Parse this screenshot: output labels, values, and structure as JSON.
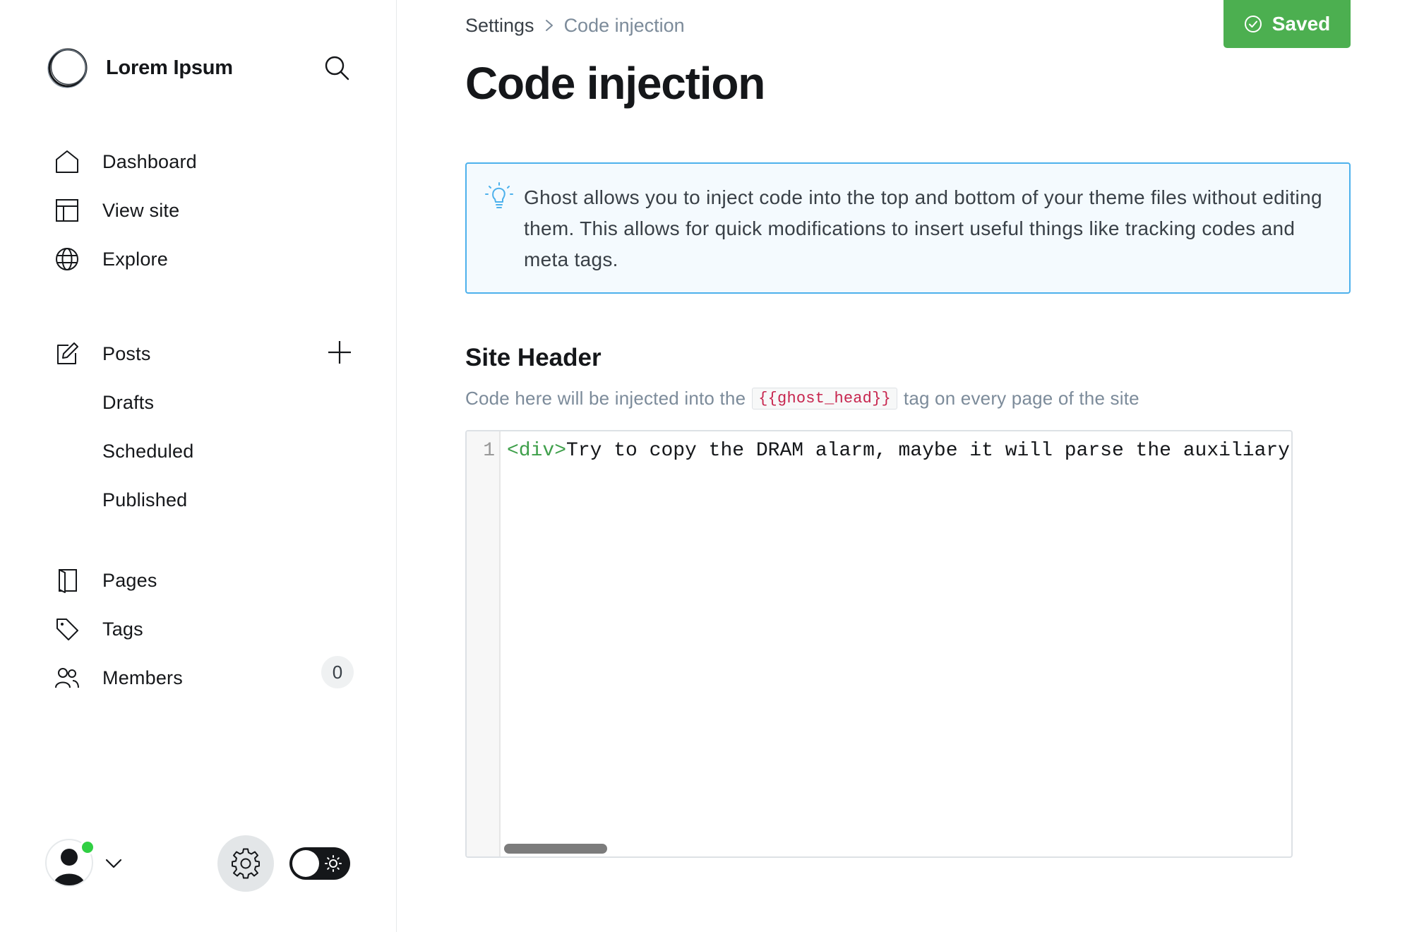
{
  "sidebar": {
    "brand_name": "Lorem Ipsum",
    "nav": {
      "dashboard": "Dashboard",
      "view_site": "View site",
      "explore": "Explore",
      "posts": "Posts",
      "drafts": "Drafts",
      "scheduled": "Scheduled",
      "published": "Published",
      "pages": "Pages",
      "tags": "Tags",
      "members": "Members",
      "members_count": "0"
    },
    "icons": [
      "logo-icon",
      "search-icon",
      "home-icon",
      "layout-icon",
      "globe-icon",
      "edit-icon",
      "plus-icon",
      "page-icon",
      "tag-icon",
      "members-icon",
      "avatar-icon",
      "chevron-down-icon",
      "gear-icon",
      "sun-icon"
    ],
    "user_online": true,
    "theme": "light"
  },
  "header": {
    "breadcrumb_root": "Settings",
    "breadcrumb_current": "Code injection",
    "saved_label": "Saved",
    "page_title": "Code injection"
  },
  "info": {
    "text": "Ghost allows you to inject code into the top and bottom of your theme files without editing them. This allows for quick modifications to insert useful things like tracking codes and meta tags."
  },
  "site_header": {
    "title": "Site Header",
    "desc_before": "Code here will be injected into the",
    "code_tag": "{{ghost_head}}",
    "desc_after": "tag on every page of the site",
    "line_number": "1",
    "code_open_tag": "<div>",
    "code_text": "Try to copy the DRAM alarm, maybe it will parse the auxiliary f"
  },
  "colors": {
    "accent_green": "#4caf50",
    "info_border": "#4db1ec",
    "code_tag": "#3e9f4a",
    "inline_code": "#c7254e",
    "online_dot": "#30cf43"
  }
}
